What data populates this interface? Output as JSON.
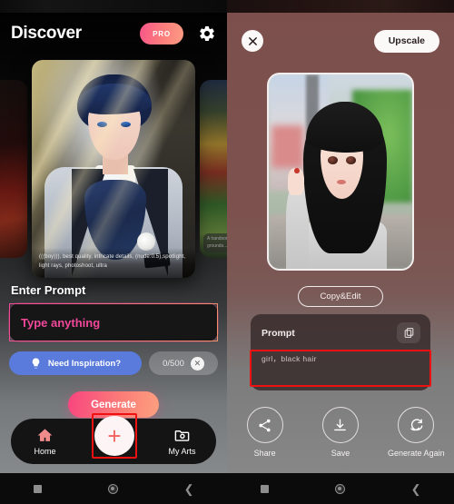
{
  "left": {
    "header": {
      "title": "Discover",
      "pro_label": "PRO",
      "settings_icon": "gear-icon"
    },
    "carousel": {
      "main_caption": "(((boy))), best quality, intricate details, (nude:0.5),spotlight, light rays, photoshoot, ultra",
      "right_caption": "A handsome\ngrounds..."
    },
    "prompt": {
      "section_label": "Enter Prompt",
      "placeholder": "Type anything",
      "value": ""
    },
    "inspiration": {
      "label": "Need Inspiration?",
      "icon": "lightbulb-icon"
    },
    "counter": {
      "text": "0/500",
      "clear_icon": "close-icon"
    },
    "generate_label": "Generate",
    "nav": {
      "home_label": "Home",
      "home_icon": "home-icon",
      "fab_icon": "plus-icon",
      "myarts_label": "My Arts",
      "myarts_icon": "photo-folder-icon"
    }
  },
  "right": {
    "header": {
      "close_icon": "close-icon",
      "upscale_label": "Upscale"
    },
    "copy_edit_label": "Copy&Edit",
    "prompt_card": {
      "title": "Prompt",
      "copy_icon": "copy-icon",
      "text": "girl，black hair"
    },
    "actions": [
      {
        "label": "Share",
        "icon": "share-icon"
      },
      {
        "label": "Save",
        "icon": "download-icon"
      },
      {
        "label": "Generate\nAgain",
        "icon": "refresh-icon"
      }
    ]
  },
  "system_bar": {
    "recents_icon": "square-icon",
    "home_icon": "circle-icon",
    "back_icon": "back-chevron-icon"
  },
  "colors": {
    "accent_pink": "#f2489a",
    "accent_salmon": "#fda07f",
    "inspiration_blue": "#5a7bdc",
    "right_panel": "#7c4f4c",
    "highlight_red": "#ee1111"
  }
}
